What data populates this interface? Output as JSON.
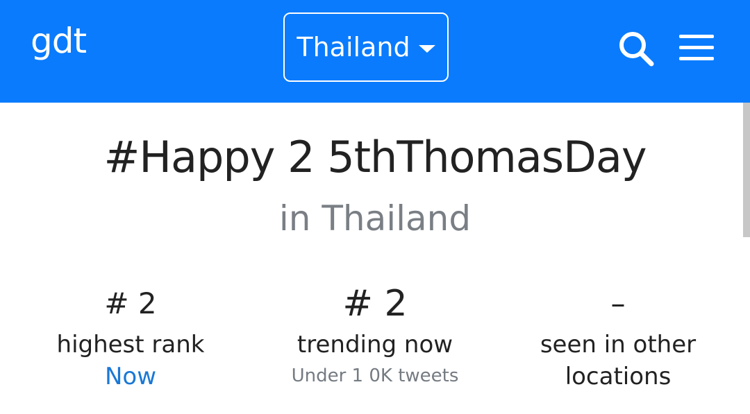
{
  "header": {
    "logo": "gdt",
    "location_select": "Thailand",
    "colors": {
      "bar": "#0a7bfd",
      "text": "#ffffff"
    },
    "icons": [
      "search-icon",
      "menu-icon",
      "caret-down-icon"
    ]
  },
  "main": {
    "hashtag": "#Happy 2 5thThomasDay",
    "location_line": "in Thailand",
    "stats": [
      {
        "value": "# 2",
        "label": "highest rank",
        "sub": "Now"
      },
      {
        "value": "# 2",
        "label": "trending now",
        "sub": "Under 1 0K tweets"
      },
      {
        "value": "–",
        "label_line1": "seen in other",
        "label_line2": "locations"
      }
    ],
    "colors": {
      "link": "#1a78d6",
      "muted": "#757b82",
      "text": "#222222"
    }
  }
}
